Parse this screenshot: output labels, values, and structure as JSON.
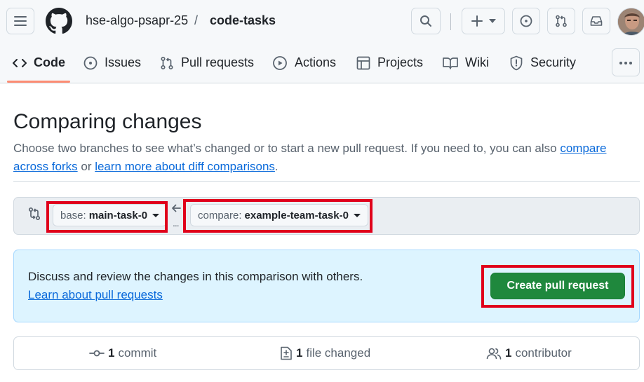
{
  "header": {
    "owner": "hse-algo-psapr-25",
    "separator": "/",
    "repo": "code-tasks",
    "icons": [
      "hamburger-menu-icon",
      "github-logo",
      "search-icon",
      "plus-icon",
      "issue-circle-icon",
      "pull-request-icon",
      "inbox-icon",
      "user-avatar"
    ]
  },
  "repo_nav": {
    "tabs": [
      {
        "label": "Code",
        "icon": "code-icon",
        "selected": true
      },
      {
        "label": "Issues",
        "icon": "issue-opened-icon"
      },
      {
        "label": "Pull requests",
        "icon": "git-pull-request-icon"
      },
      {
        "label": "Actions",
        "icon": "play-icon"
      },
      {
        "label": "Projects",
        "icon": "table-icon"
      },
      {
        "label": "Wiki",
        "icon": "book-icon"
      },
      {
        "label": "Security",
        "icon": "shield-icon"
      }
    ],
    "more_icon": "kebab-horizontal-icon"
  },
  "page": {
    "title": "Comparing changes",
    "desc_prefix": "Choose two branches to see what’s changed or to start a new pull request. If you need to, you can also ",
    "link_forks": "compare across forks",
    "desc_middle": " or ",
    "link_diff": "learn more about diff comparisons",
    "desc_suffix": "."
  },
  "range": {
    "base_label": "base:",
    "base_branch": "main-task-0",
    "compare_label": "compare:",
    "compare_branch": "example-team-task-0",
    "arrow": "←",
    "dots": "..."
  },
  "pr_box": {
    "text": "Discuss and review the changes in this comparison with others.",
    "link": "Learn about pull requests",
    "button": "Create pull request"
  },
  "stats": {
    "commits_count": "1",
    "commits_label": "commit",
    "files_count": "1",
    "files_label": "file changed",
    "contributors_count": "1",
    "contributors_label": "contributor"
  },
  "colors": {
    "accent_link": "#0969da",
    "primary_button": "#1f883d",
    "selected_tab_underline": "#fd8c73",
    "annotation_highlight": "#e0001b",
    "info_box_bg": "#ddf4ff"
  }
}
